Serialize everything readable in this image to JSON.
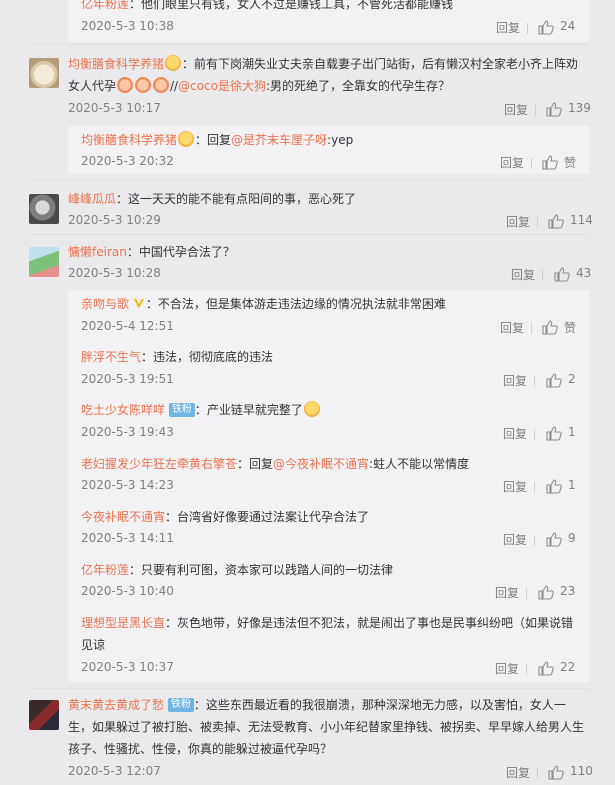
{
  "reply_label": "回复",
  "comments": [
    {
      "user": "亿年粉莲",
      "text": "：他们眼里只有钱，女人不过是赚钱工具，不管死活都能赚钱",
      "time": "2020-5-3 10:38",
      "likes": "24"
    },
    {
      "user": "均衡膳食科学养猪",
      "text1": "：前有下岗潮失业丈夫亲自载妻子出门站街，后有懒汉村全家老小齐上阵劝",
      "text2a": "女人代孕",
      "text2b": "//",
      "mention": "@coco是徐大狗",
      "text2c": ":男的死绝了，全靠女的代孕生存？",
      "time": "2020-5-3 10:17",
      "likes": "139",
      "sub": {
        "user": "均衡膳食科学养猪",
        "text_a": "：回复",
        "mention": "@是芥末车厘子呀",
        "text_b": ":yep",
        "time": "2020-5-3 20:32",
        "likes": "赞"
      }
    },
    {
      "user": "峰峰瓜瓜",
      "text": "：这一天天的能不能有点阳间的事，恶心死了",
      "time": "2020-5-3 10:29",
      "likes": "114"
    },
    {
      "user": "慵懒feiran",
      "text": "：中国代孕合法了？",
      "time": "2020-5-3 10:28",
      "likes": "43",
      "subs": [
        {
          "user": "亲吻与歌",
          "text": "：不合法，但是集体游走违法边缘的情况执法就非常困难",
          "time": "2020-5-4 12:51",
          "likes": "赞"
        },
        {
          "user": "胖浮不生气",
          "text": "：违法，彻彻底底的违法",
          "time": "2020-5-3 19:51",
          "likes": "2"
        },
        {
          "user": "吃土少女陈咩咩",
          "badge": "铁粉",
          "text": "：产业链早就完整了",
          "time": "2020-5-3 19:43",
          "likes": "1"
        },
        {
          "user": "老妇握发少年狂左牵黄右擎苍",
          "text_a": "：回复",
          "mention": "@今夜补眠不通宵",
          "text_b": ":蛀人不能以常情度",
          "time": "2020-5-3 14:23",
          "likes": "1"
        },
        {
          "user": "今夜补眠不通宵",
          "text": "：台湾省好像要通过法案让代孕合法了",
          "time": "2020-5-3 14:11",
          "likes": "9"
        },
        {
          "user": "亿年粉莲",
          "text": "：只要有利可图，资本家可以践踏人间的一切法律",
          "time": "2020-5-3 10:40",
          "likes": "23"
        },
        {
          "user": "理想型是黑长直",
          "text1": "：灰色地带，好像是违法但不犯法，就是闹出了事也是民事纠纷吧（如果说错",
          "text2": "见谅",
          "time": "2020-5-3 10:37",
          "likes": "22"
        }
      ]
    },
    {
      "user": "黄末黄去黄成了愁",
      "badge": "铁粉",
      "text1": "：这些东西最近看的我很崩溃，那种深深地无力感，以及害怕，女人一",
      "text2": "生，如果躲过了被打胎、被卖掉、无法受教育、小小年纪替家里挣钱、被拐卖、早早嫁人给男人生",
      "text3": "孩子、性骚扰、性侵，你真的能躲过被逼代孕吗？",
      "time": "2020-5-3 12:07",
      "likes": "110"
    }
  ]
}
